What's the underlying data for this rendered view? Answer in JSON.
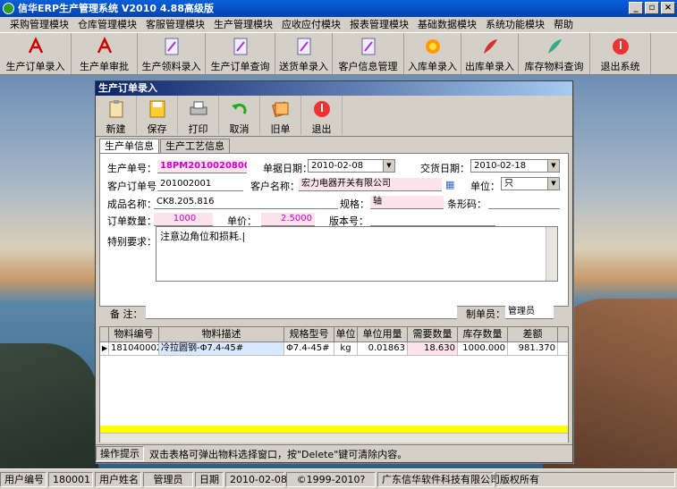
{
  "window": {
    "title": "信华ERP生产管理系统  V2010 4.88高级版"
  },
  "menubar": [
    "采购管理模块",
    "仓库管理模块",
    "客服管理模块",
    "生产管理模块",
    "应收应付模块",
    "报表管理模块",
    "基础数据模块",
    "系统功能模块",
    "帮助"
  ],
  "toolbar": [
    {
      "label": "生产订单录入",
      "icon": "pdf-icon"
    },
    {
      "label": "生产单审批",
      "icon": "pdf-icon"
    },
    {
      "label": "生产领料录入",
      "icon": "document-icon"
    },
    {
      "label": "生产订单查询",
      "icon": "document-icon"
    },
    {
      "label": "送货单录入",
      "icon": "document-icon"
    },
    {
      "label": "客户信息管理",
      "icon": "document-icon"
    },
    {
      "label": "入库单录入",
      "icon": "flower-icon"
    },
    {
      "label": "出库单录入",
      "icon": "quill-icon"
    },
    {
      "label": "库存物料查询",
      "icon": "feather-icon"
    },
    {
      "label": "退出系统",
      "icon": "exit-icon"
    }
  ],
  "child": {
    "title": "生产订单录入",
    "buttons": [
      "新建",
      "保存",
      "打印",
      "取消",
      "旧单",
      "退出"
    ],
    "tabs": [
      "生产单信息",
      "生产工艺信息"
    ],
    "form": {
      "order_no_label": "生产单号：",
      "order_no": "18PM20100208001",
      "doc_date_label": "单据日期：",
      "doc_date": "2010-02-08",
      "delivery_date_label": "交货日期：",
      "delivery_date": "2010-02-18",
      "cust_order_label": "客户订单号",
      "cust_order": "201002001",
      "cust_name_label": "客户名称：",
      "cust_name": "宏力电器开关有限公司",
      "unit_label": "单位：",
      "unit": "只",
      "product_label": "成品名称：",
      "product": "CK8.205.816",
      "spec_label": "规格：",
      "spec": "轴",
      "barcode_label": "条形码：",
      "barcode": "",
      "qty_label": "订单数量：",
      "qty": "1000",
      "price_label": "单价：",
      "price": "2.5000",
      "version_label": "版本号：",
      "version": "",
      "special_label": "特别要求：",
      "special": "注意边角位和损耗.|",
      "remark_label": "备  注：",
      "remark": "",
      "maker_label": "制单员：",
      "maker": "管理员"
    },
    "grid": {
      "headers": [
        "物料编号",
        "物料描述",
        "规格型号",
        "单位",
        "单位用量",
        "需要数量",
        "库存数量",
        "差额"
      ],
      "rows": [
        [
          "1810400020",
          "冷拉圆钢-Φ7.4-45#",
          "Φ7.4-45#",
          "kg",
          "0.01863",
          "18.630",
          "1000.000",
          "981.370"
        ]
      ]
    },
    "hint_label": "操作提示",
    "hint": "双击表格可弹出物料选择窗口，按\"Delete\"键可清除内容。"
  },
  "status": {
    "user_id_label": "用户编号",
    "user_id": "180001",
    "user_name_label": "用户姓名",
    "user_name": "管理员",
    "date_label": "日期",
    "date": "2010-02-08",
    "copyright": "©1999-2010?",
    "company": "广东信华软件科技有限公司",
    "rights": "版权所有"
  }
}
